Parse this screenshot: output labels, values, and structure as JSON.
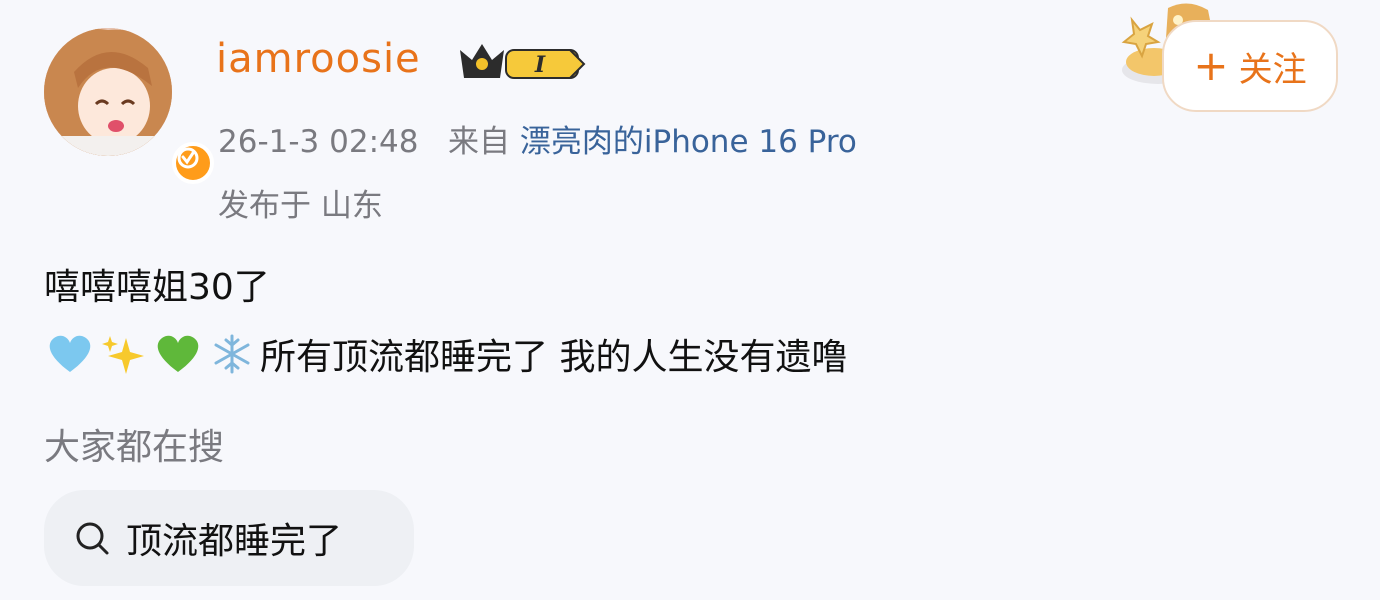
{
  "user": {
    "name": "iamroosie",
    "badge_level": "I"
  },
  "meta": {
    "time": "26-1-3 02:48",
    "from_label": "来自",
    "device": "漂亮肉的iPhone 16 Pro",
    "location": "发布于 山东"
  },
  "follow": {
    "plus": "+",
    "label": "关注"
  },
  "post": {
    "line1": "嘻嘻嘻姐30了",
    "line2": "所有顶流都睡完了 我的人生没有遗噜",
    "emojis": [
      "light-blue-heart",
      "sparkles",
      "green-heart",
      "snowflake"
    ]
  },
  "search": {
    "title": "大家都在搜",
    "chip": "顶流都睡完了"
  },
  "colors": {
    "username": "#e8731a",
    "link": "#39639a",
    "meta": "#7a7a80",
    "verified": "#ff9c1a"
  }
}
